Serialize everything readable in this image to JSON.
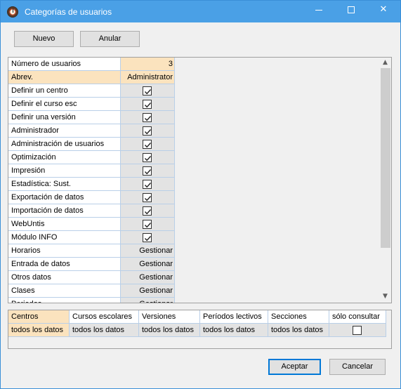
{
  "window": {
    "title": "Categorías de usuarios",
    "minimize_icon": "minimize-icon",
    "maximize_icon": "maximize-icon",
    "close_icon": "close-icon",
    "close_glyph": "✕"
  },
  "toolbar": {
    "new_label": "Nuevo",
    "cancel_label": "Anular"
  },
  "properties": [
    {
      "label": "Número de usuarios",
      "type": "text",
      "value": "3"
    },
    {
      "label": "Abrev.",
      "type": "text",
      "value": "Administrator"
    },
    {
      "label": "Definir un centro",
      "type": "check",
      "checked": true
    },
    {
      "label": "Definir el curso esc",
      "type": "check",
      "checked": true
    },
    {
      "label": "Definir una versión",
      "type": "check",
      "checked": true
    },
    {
      "label": "Administrador",
      "type": "check",
      "checked": true
    },
    {
      "label": "Administración de usuarios",
      "type": "check",
      "checked": true
    },
    {
      "label": "Optimización",
      "type": "check",
      "checked": true
    },
    {
      "label": "Impresión",
      "type": "check",
      "checked": true
    },
    {
      "label": "Estadística: Sust.",
      "type": "check",
      "checked": true
    },
    {
      "label": "Exportación de datos",
      "type": "check",
      "checked": true
    },
    {
      "label": "Importación de datos",
      "type": "check",
      "checked": true
    },
    {
      "label": "WebUntis",
      "type": "check",
      "checked": true
    },
    {
      "label": "Módulo INFO",
      "type": "check",
      "checked": true
    },
    {
      "label": "Horarios",
      "type": "text",
      "value": "Gestionar"
    },
    {
      "label": "Entrada de datos",
      "type": "text",
      "value": "Gestionar"
    },
    {
      "label": "Otros datos",
      "type": "text",
      "value": "Gestionar"
    },
    {
      "label": "Clases",
      "type": "text",
      "value": "Gestionar"
    },
    {
      "label": "Periodos",
      "type": "text",
      "value": "Gestionar"
    }
  ],
  "scope_grid": {
    "headers": [
      "Centros",
      "Cursos escolares",
      "Versiones",
      "Períodos lectivos",
      "Secciones",
      "sólo consultar"
    ],
    "values": [
      "todos los datos",
      "todos los datos",
      "todos los datos",
      "todos los datos",
      "todos los datos",
      ""
    ],
    "consult_only_checked": false
  },
  "footer": {
    "accept_label": "Aceptar",
    "cancel_label": "Cancelar"
  },
  "colors": {
    "titlebar": "#4aa0e6",
    "highlight": "#fbe3be",
    "grid_line": "#b9cfe8"
  }
}
